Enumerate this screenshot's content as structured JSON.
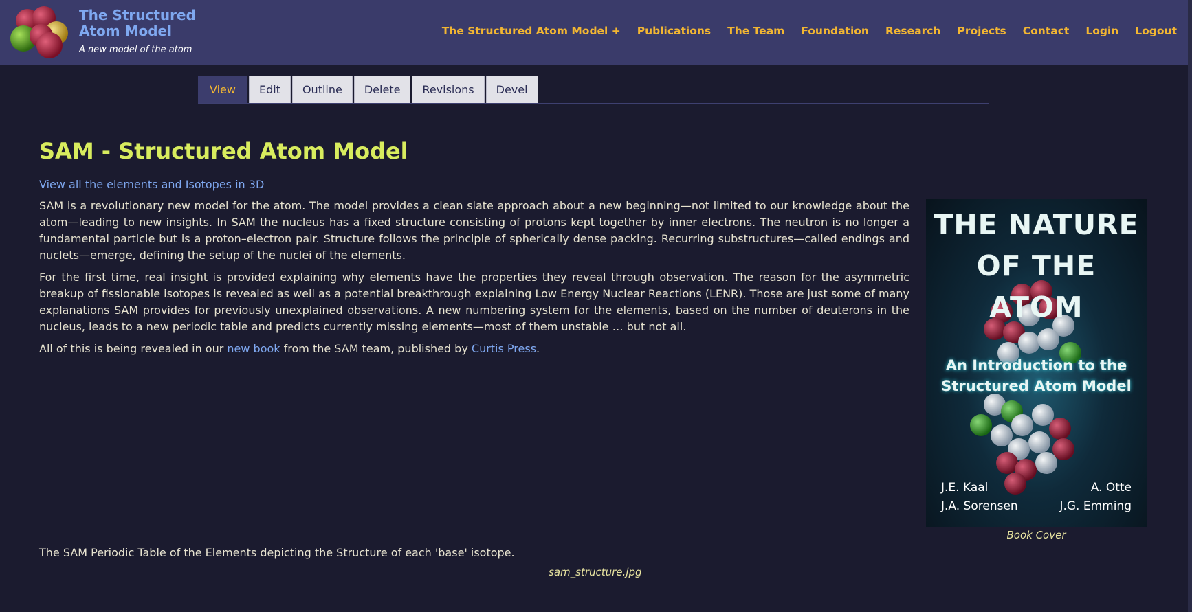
{
  "header": {
    "site_title": "The Structured Atom Model",
    "slogan": "A new model of the atom",
    "nav": [
      "The Structured Atom Model +",
      "Publications",
      "The Team",
      "Foundation",
      "Research",
      "Projects",
      "Contact",
      "Login",
      "Logout"
    ]
  },
  "tabs": [
    "View",
    "Edit",
    "Outline",
    "Delete",
    "Revisions",
    "Devel"
  ],
  "active_tab": "View",
  "main": {
    "title": "SAM - Structured Atom Model",
    "link_3d": "View all the elements and Isotopes in 3D",
    "paragraph1": "SAM is a revolutionary new model for the atom. The model provides a clean slate approach about a new beginning—not limited to our knowledge about the atom—leading to new insights. In SAM the nucleus has a fixed structure consisting of protons kept together by inner electrons. The neutron is no longer a fundamental particle but is a proton–electron pair. Structure follows the principle of spherically dense packing. Recurring substructures—called endings and nuclets—emerge, defining the setup of the nuclei of the elements.",
    "paragraph2": "For the first time, real insight is provided explaining why elements have the properties they reveal through observation. The reason for the asymmetric breakup of fissionable isotopes is revealed as well as a potential breakthrough explaining Low Energy Nuclear Reactions (LENR). Those are just some of many explanations SAM provides for previously unexplained observations. A new numbering system for the elements, based on the number of deuterons in the nucleus, leads to a new periodic table and predicts currently missing elements—most of them unstable … but not all.",
    "p3_before": "All of this is being revealed in our ",
    "p3_link1": "new book",
    "p3_middle": " from the SAM team, published by ",
    "p3_link2": "Curtis Press",
    "p3_after": ".",
    "periodic_text": "The SAM Periodic Table of the Elements depicting the Structure of each 'base' isotope.",
    "image_caption": "sam_structure.jpg"
  },
  "book": {
    "title_line1": "THE NATURE",
    "title_line2": "OF THE ATOM",
    "subtitle_line1": "An Introduction to the",
    "subtitle_line2": "Structured Atom Model",
    "author1": "J.E. Kaal",
    "author2": "A. Otte",
    "author3": "J.A. Sorensen",
    "author4": "J.G. Emming",
    "caption": "Book Cover"
  },
  "colors": {
    "background": "#1b1b2f",
    "header": "#3a3b6a",
    "nav_link": "#f2b632",
    "title": "#d8ec5e",
    "link": "#7fa8f0"
  }
}
